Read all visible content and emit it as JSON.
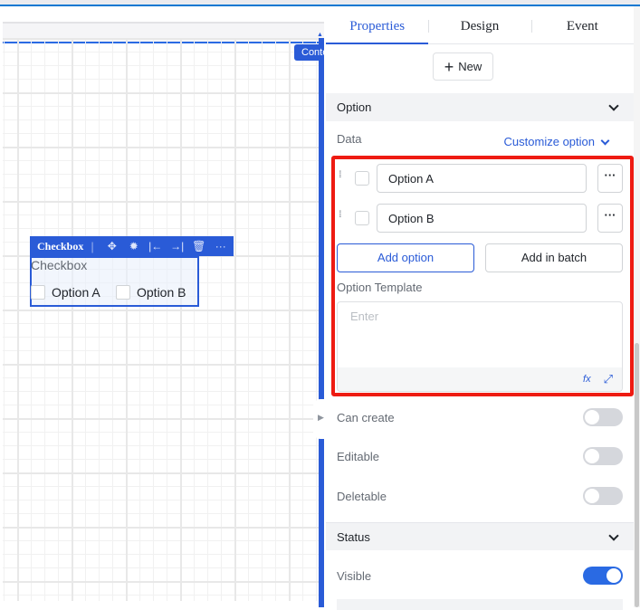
{
  "canvas": {
    "container_tag": "Conte",
    "component": {
      "toolbar_title": "Checkbox",
      "label": "Checkbox",
      "options": [
        "Option A",
        "Option B"
      ],
      "toolbar_icons": [
        "move-icon",
        "bug-icon",
        "align-left-icon",
        "align-right-icon",
        "delete-icon",
        "more-icon"
      ]
    }
  },
  "panel": {
    "tabs": [
      "Properties",
      "Design",
      "Event"
    ],
    "new_label": "New",
    "option_section": "Option",
    "data_label": "Data",
    "customize_label": "Customize option",
    "options": [
      "Option A",
      "Option B"
    ],
    "add_option": "Add option",
    "add_batch": "Add in batch",
    "template_label": "Option Template",
    "template_placeholder": "Enter",
    "fx_label": "fx",
    "toggles": [
      {
        "label": "Can create",
        "on": false
      },
      {
        "label": "Editable",
        "on": false
      },
      {
        "label": "Deletable",
        "on": false
      }
    ],
    "status_section": "Status",
    "visible_label": "Visible",
    "visible_on": true
  }
}
